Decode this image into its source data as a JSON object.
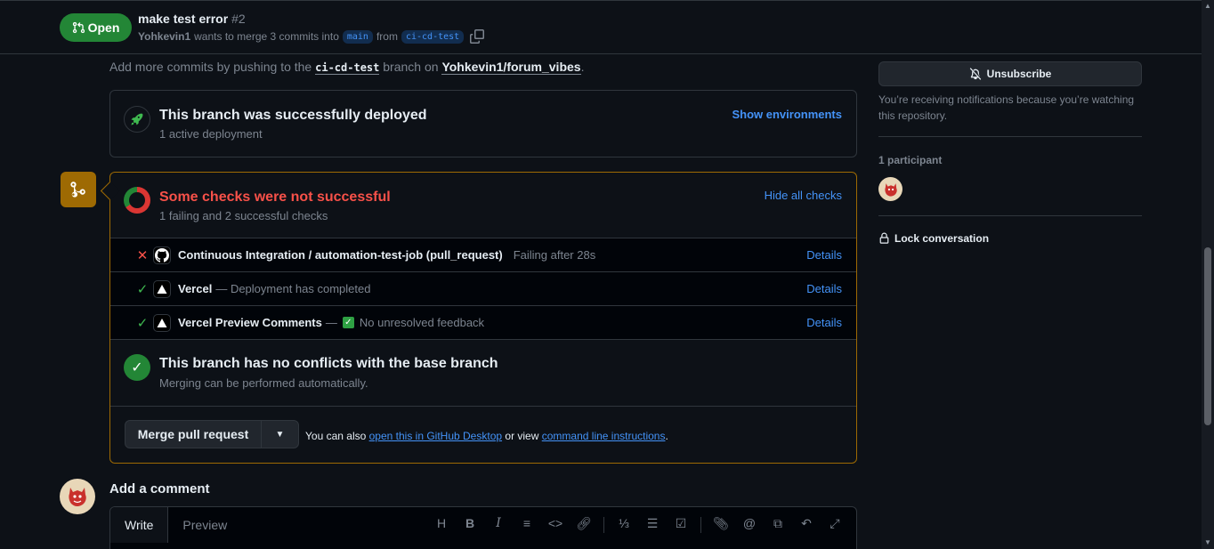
{
  "header": {
    "state": "Open",
    "title": "make test error",
    "number": "#2",
    "author": "Yohkevin1",
    "merge_text": "wants to merge 3 commits into",
    "base_branch": "main",
    "from_text": "from",
    "head_branch": "ci-cd-test"
  },
  "push_note": {
    "prefix": "Add more commits by pushing to the",
    "branch": "ci-cd-test",
    "mid": "branch on",
    "repo": "Yohkevin1/forum_vibes",
    "suffix": "."
  },
  "deployment": {
    "title": "This branch was successfully deployed",
    "subtitle": "1 active deployment",
    "link": "Show environments"
  },
  "checks": {
    "title": "Some checks were not successful",
    "subtitle": "1 failing and 2 successful checks",
    "toggle": "Hide all checks",
    "items": [
      {
        "status": "fail",
        "name": "Continuous Integration / automation-test-job (pull_request)",
        "description": "Failing after 28s",
        "details": "Details"
      },
      {
        "status": "success",
        "name": "Vercel",
        "description": "— Deployment has completed",
        "details": "Details"
      },
      {
        "status": "success",
        "name": "Vercel Preview Comments",
        "description_prefix": "—",
        "description": "No unresolved feedback",
        "details": "Details"
      }
    ]
  },
  "conflicts": {
    "title": "This branch has no conflicts with the base branch",
    "subtitle": "Merging can be performed automatically."
  },
  "merge": {
    "button": "Merge pull request",
    "hint_prefix": "You can also",
    "desktop_link": "open this in GitHub Desktop",
    "hint_mid": "or view",
    "cli_link": "command line instructions",
    "hint_suffix": "."
  },
  "comment": {
    "heading": "Add a comment",
    "tabs": [
      "Write",
      "Preview"
    ],
    "toolbar_icons": [
      "heading-icon",
      "bold-icon",
      "italic-icon",
      "quote-icon",
      "code-icon",
      "link-icon",
      "ordered-list-icon",
      "unordered-list-icon",
      "task-list-icon",
      "attach-icon",
      "mention-icon",
      "reference-icon",
      "reply-icon",
      "fullscreen-icon"
    ]
  },
  "sidebar": {
    "unsubscribe": "Unsubscribe",
    "notification_reason": "You’re receiving notifications because you’re watching this repository.",
    "participants_label": "1 participant",
    "lock": "Lock conversation"
  },
  "colors": {
    "open_green": "#238636",
    "fail_red": "#f85149",
    "link_blue": "#4493f8",
    "attention_border": "#9e6a03",
    "background": "#0d1117"
  }
}
